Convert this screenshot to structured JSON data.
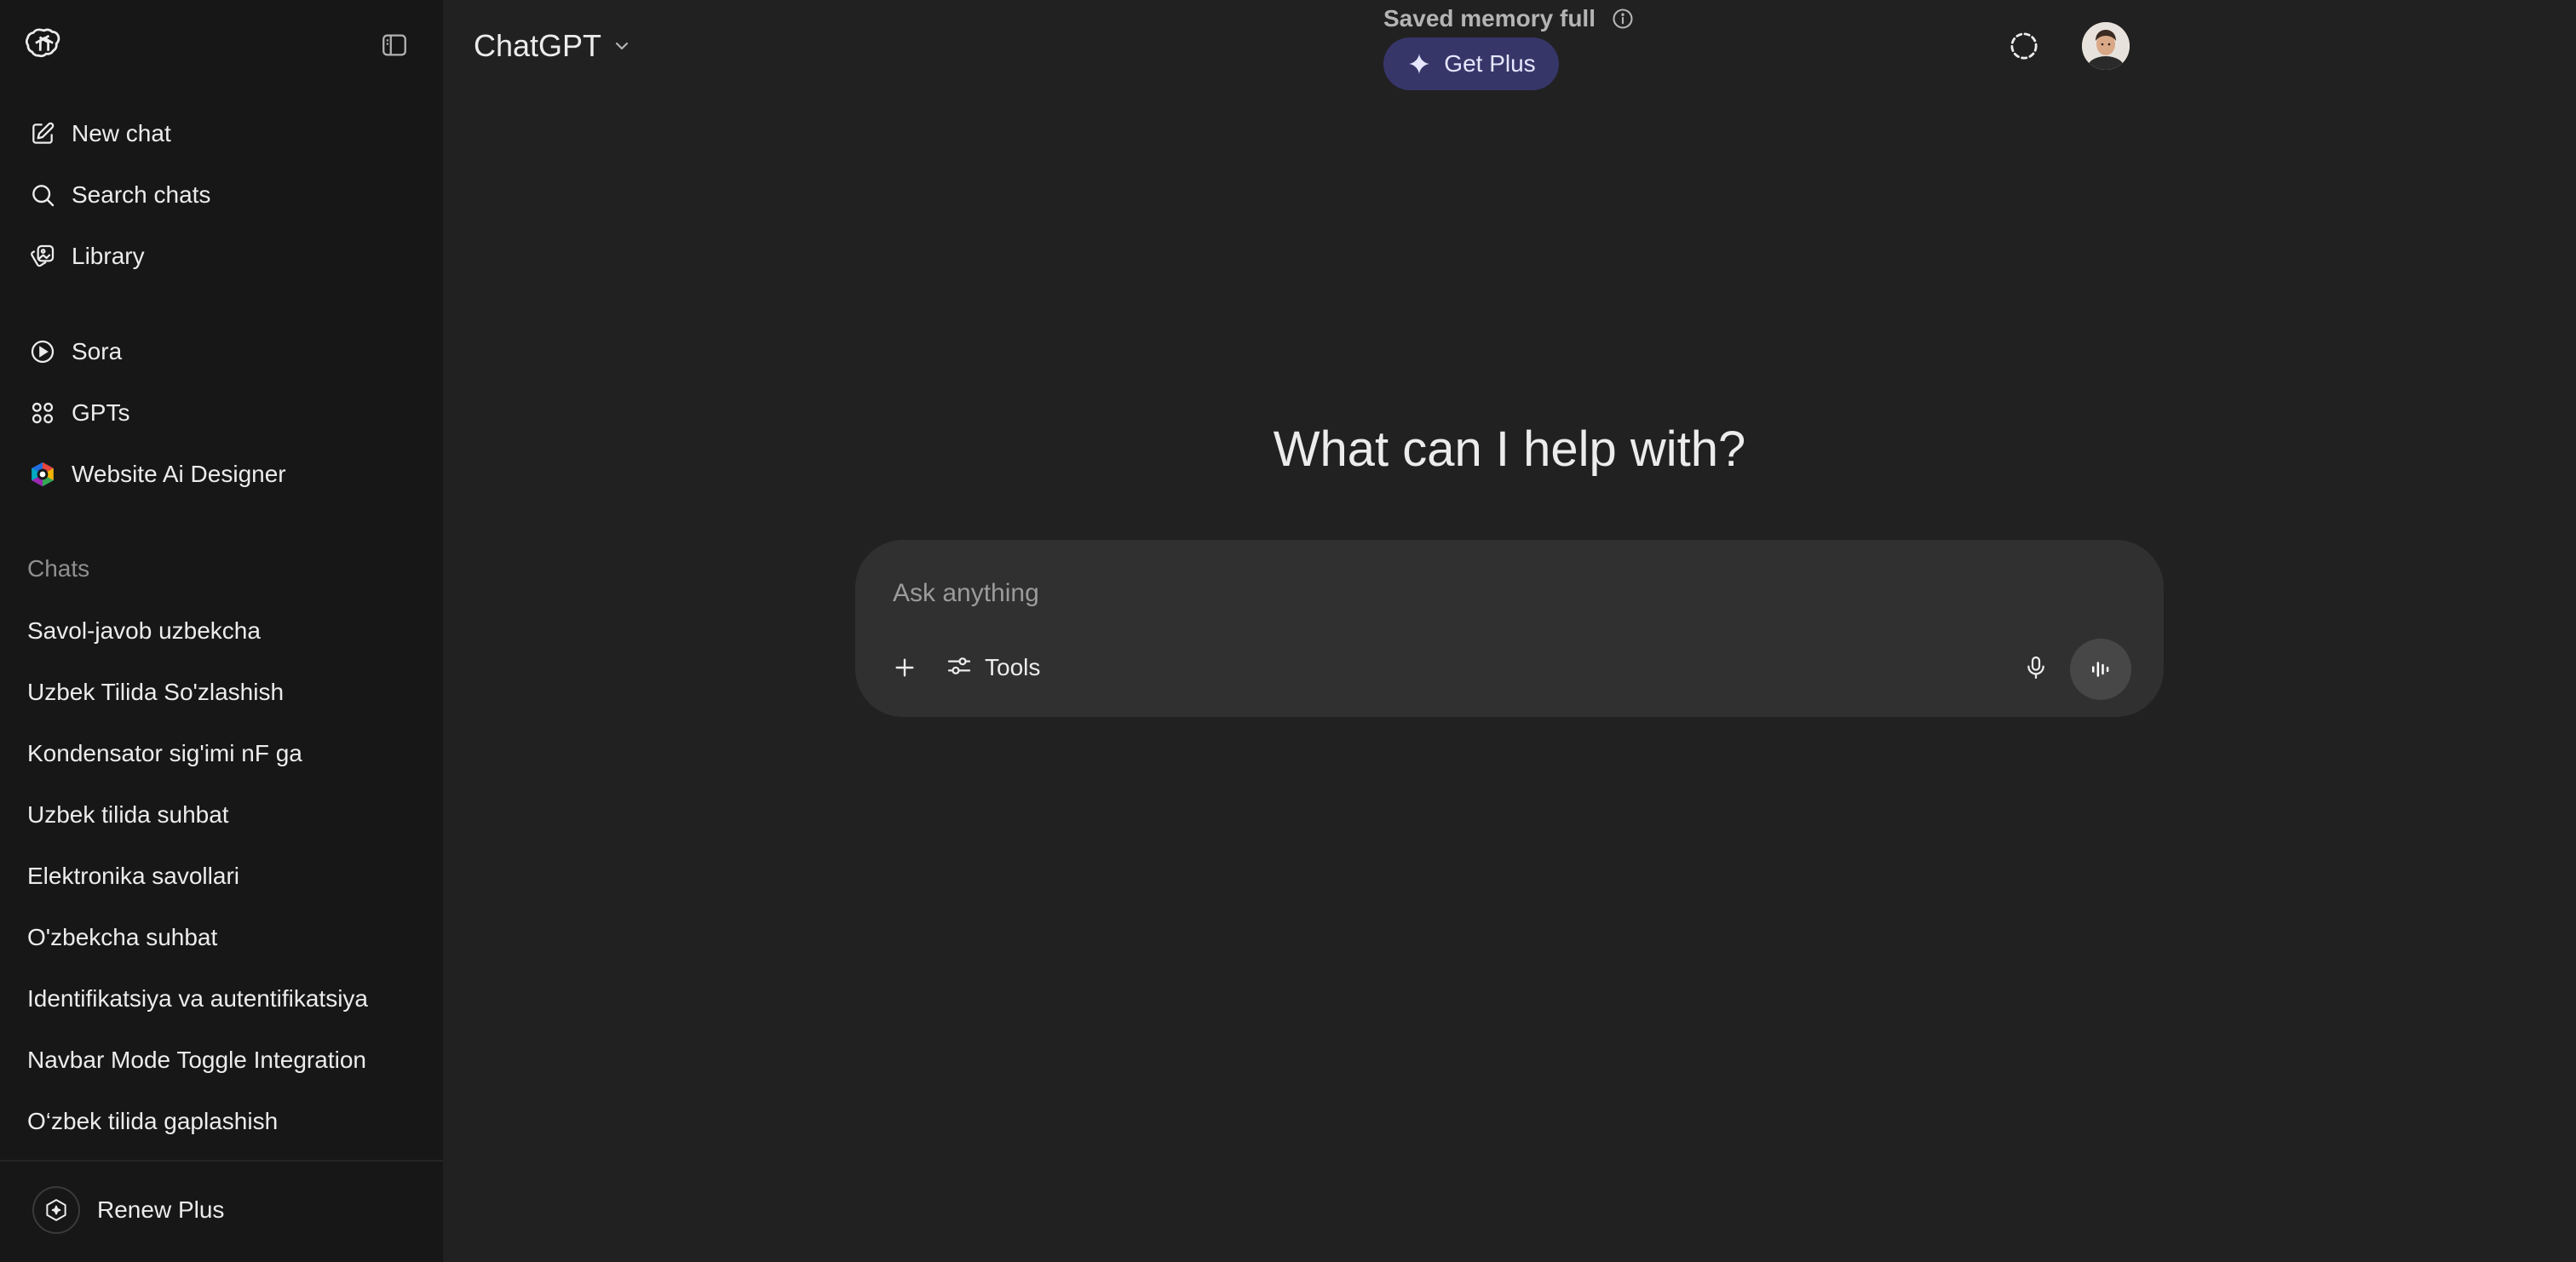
{
  "sidebar": {
    "nav": [
      {
        "label": "New chat",
        "icon": "new-chat-icon"
      },
      {
        "label": "Search chats",
        "icon": "search-icon"
      },
      {
        "label": "Library",
        "icon": "library-icon"
      }
    ],
    "apps": [
      {
        "label": "Sora",
        "icon": "play-icon"
      },
      {
        "label": "GPTs",
        "icon": "gpts-grid-icon"
      },
      {
        "label": "Website Ai Designer",
        "icon": "gpt-logo-icon"
      }
    ],
    "chats_heading": "Chats",
    "chats": [
      "Savol-javob uzbekcha",
      "Uzbek Tilida So'zlashish",
      "Kondensator sig'imi nF ga",
      "Uzbek tilida suhbat",
      "Elektronika savollari",
      "O'zbekcha suhbat",
      "Identifikatsiya va autentifikatsiya",
      "Navbar Mode Toggle Integration",
      "O‘zbek tilida gaplashish"
    ],
    "renew_label": "Renew Plus"
  },
  "header": {
    "model_name": "ChatGPT",
    "memory_notice": "Saved memory full",
    "get_plus_label": "Get Plus"
  },
  "main": {
    "headline": "What can I help with?",
    "composer": {
      "placeholder": "Ask anything",
      "tools_label": "Tools"
    }
  },
  "colors": {
    "sidebar_bg": "#171717",
    "main_bg": "#212121",
    "composer_bg": "#303030",
    "get_plus_bg": "#373669"
  }
}
